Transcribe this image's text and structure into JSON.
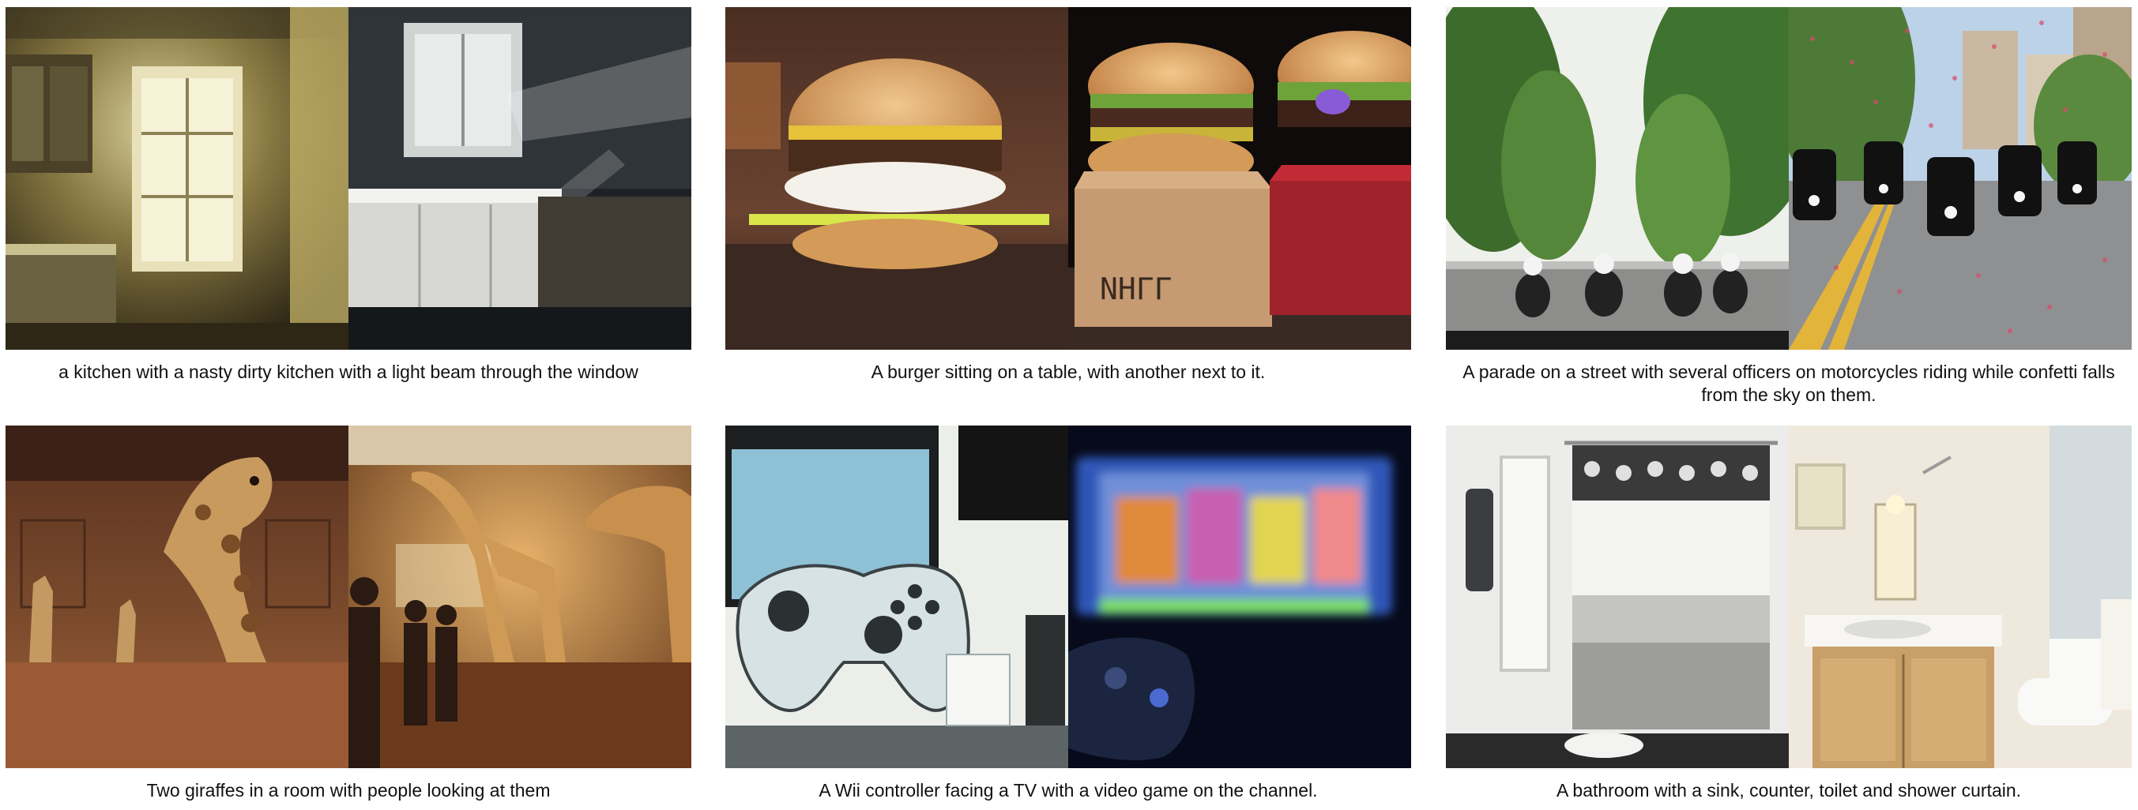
{
  "panels": [
    {
      "caption": "a kitchen with a nasty dirty kitchen with a light beam through the window",
      "left_image": "dirty-kitchen-window-photo",
      "right_image": "kitchen-light-beam-photo"
    },
    {
      "caption": "A burger sitting on a table, with another next to it.",
      "left_image": "burger-on-table-photo",
      "right_image": "two-burgers-photo"
    },
    {
      "caption": "A parade on a street with several officers on motorcycles riding while confetti falls from the sky on them.",
      "left_image": "motorcycle-parade-tree-street-photo",
      "right_image": "motorcycle-officers-confetti-photo"
    },
    {
      "caption": "Two giraffes in a room with people looking at them",
      "left_image": "giraffes-wood-room-photo",
      "right_image": "giraffes-hall-people-photo"
    },
    {
      "caption": "A Wii controller facing a TV with a video game on the channel.",
      "left_image": "game-controller-monitor-photo",
      "right_image": "controller-blurry-tv-photo"
    },
    {
      "caption": "A bathroom with a sink, counter, toilet and shower curtain.",
      "left_image": "shower-curtain-bathroom-photo",
      "right_image": "vanity-toilet-bathroom-photo"
    }
  ],
  "right_image_embedded_text": "ΝΗΓΓ"
}
